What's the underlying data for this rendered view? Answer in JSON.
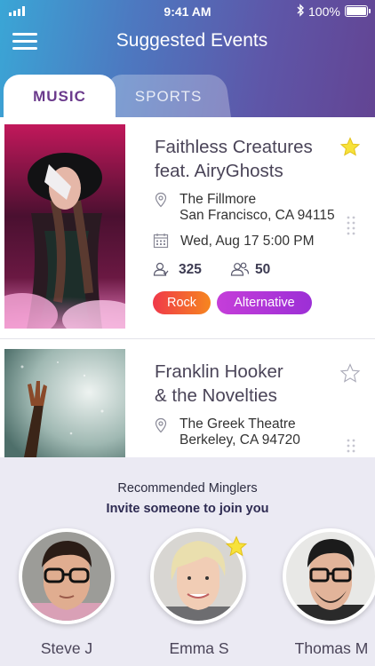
{
  "status_bar": {
    "time": "9:41 AM",
    "battery": "100%"
  },
  "header": {
    "title": "Suggested Events",
    "menu_icon": "hamburger-menu-icon"
  },
  "tabs": [
    {
      "label": "MUSIC",
      "active": true
    },
    {
      "label": "SPORTS",
      "active": false
    }
  ],
  "events": [
    {
      "title_line1": "Faithless Creatures",
      "title_line2": "feat. AiryGhosts",
      "starred": true,
      "venue_name": "The Fillmore",
      "venue_city": "San Francisco, CA 94115",
      "date": "Wed, Aug 17 5:00 PM",
      "attendees": "325",
      "friends": "50",
      "genres": [
        "Rock",
        "Alternative"
      ]
    },
    {
      "title_line1": "Franklin Hooker",
      "title_line2": "& the Novelties",
      "starred": false,
      "venue_name": "The Greek Theatre",
      "venue_city": "Berkeley, CA 94720"
    }
  ],
  "minglers": {
    "heading": "Recommended Minglers",
    "subheading": "Invite someone to join you",
    "people": [
      {
        "name": "Steve J",
        "starred": false
      },
      {
        "name": "Emma S",
        "starred": true
      },
      {
        "name": "Thomas M",
        "starred": false
      }
    ]
  },
  "colors": {
    "accent_purple": "#6b3a8c",
    "star_yellow": "#f7e23a",
    "rock_gradient_start": "#f0394a",
    "rock_gradient_end": "#f6861f",
    "alt_gradient_start": "#c53ed9",
    "alt_gradient_end": "#9c2fd6"
  }
}
